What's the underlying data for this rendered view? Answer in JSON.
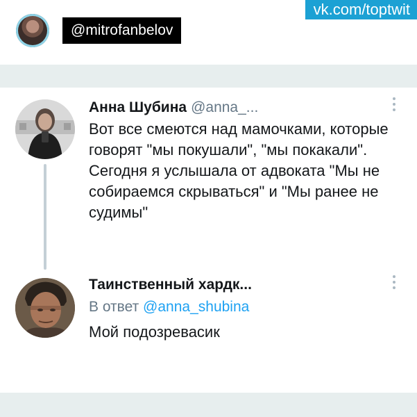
{
  "header": {
    "handle": "@mitrofanbelov",
    "watermark": "vk.com/toptwit"
  },
  "tweets": [
    {
      "author_name": "Анна Шубина",
      "author_handle": "@anna_...",
      "text": "Вот все смеются над мамочками, которые говорят \"мы покушали\", \"мы покакали\". Сегодня я услышала от адвоката \"Мы не собираемся скрываться\" и \"Мы ранее не судимы\""
    },
    {
      "author_name": "Таинственный хардк...",
      "reply_prefix": "В ответ",
      "reply_mention": "@anna_shubina",
      "text": "Мой подозревасик"
    }
  ],
  "icons": {
    "more": "vertical-ellipsis-icon",
    "profile": "avatar"
  },
  "colors": {
    "watermark_bg": "#1ca1d4",
    "mention": "#1da1f2",
    "secondary_text": "#657786",
    "strip": "#e7eeee"
  }
}
